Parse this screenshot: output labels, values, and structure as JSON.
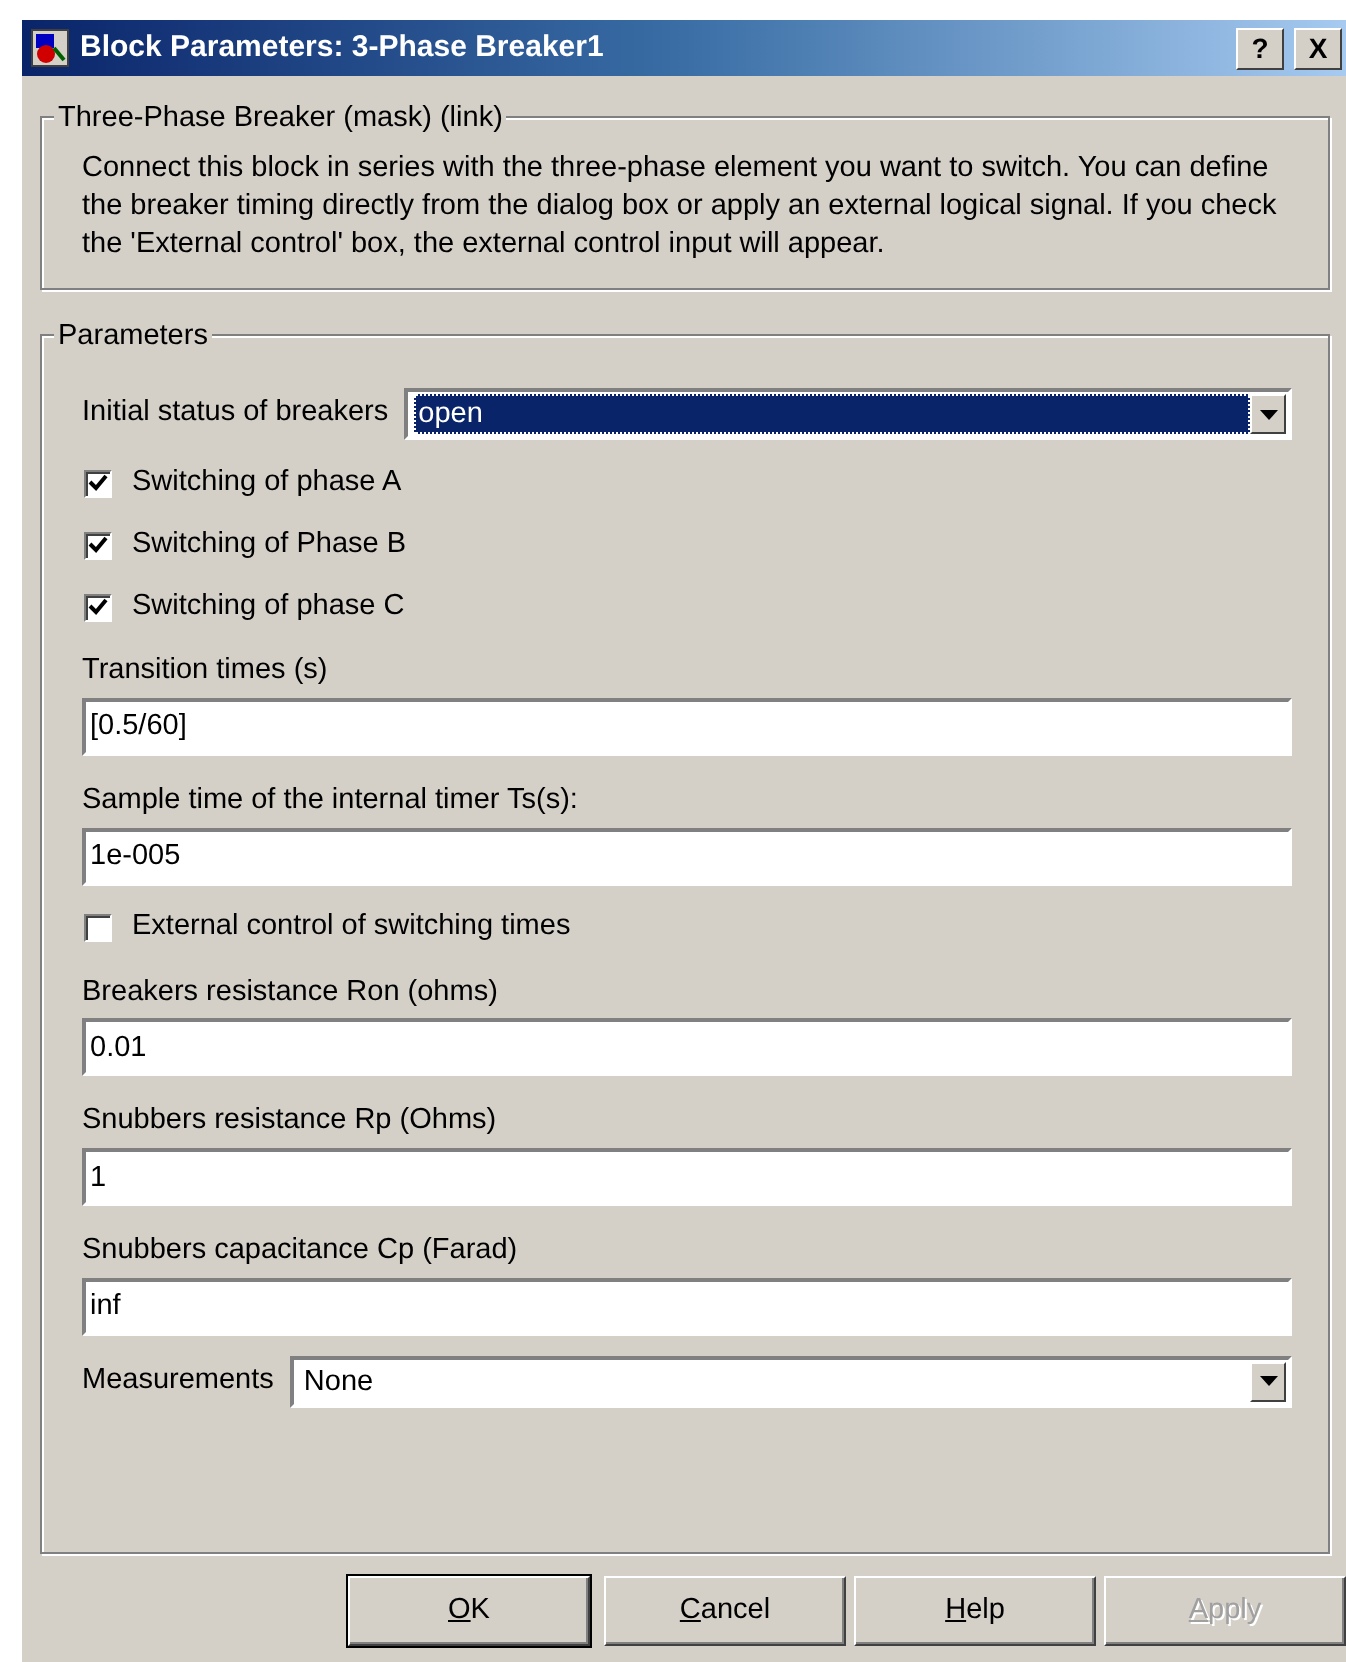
{
  "window": {
    "title": "Block Parameters: 3-Phase Breaker1",
    "help_glyph": "?",
    "close_glyph": "X"
  },
  "description": {
    "legend": "Three-Phase Breaker (mask) (link)",
    "text": "Connect this block in series with the three-phase element you want to switch. You can define the breaker timing directly from the dialog box or apply an external logical signal. If you check  the 'External control' box, the external control input will appear."
  },
  "parameters": {
    "legend": "Parameters",
    "items": [
      {
        "kind": "dropdown",
        "label": "Initial status of breakers",
        "value": "open",
        "focused": true
      },
      {
        "kind": "checkbox",
        "label": "Switching of phase A",
        "checked": true
      },
      {
        "kind": "checkbox",
        "label": "Switching of Phase B",
        "checked": true
      },
      {
        "kind": "checkbox",
        "label": "Switching of phase C",
        "checked": true
      },
      {
        "kind": "text",
        "label": "Transition times (s)",
        "value": "[0.5/60]"
      },
      {
        "kind": "text",
        "label": "Sample time of the internal timer Ts(s):",
        "value": "1e-005"
      },
      {
        "kind": "checkbox",
        "label": "External control of switching times",
        "checked": false
      },
      {
        "kind": "text",
        "label": "Breakers resistance Ron (ohms)",
        "value": "0.01"
      },
      {
        "kind": "text",
        "label": "Snubbers resistance Rp (Ohms)",
        "value": "1"
      },
      {
        "kind": "text",
        "label": "Snubbers capacitance Cp (Farad)",
        "value": "inf"
      },
      {
        "kind": "dropdown",
        "label": "Measurements",
        "value": "None",
        "focused": false
      }
    ]
  },
  "buttons": [
    {
      "label": "OK",
      "default": true,
      "disabled": false
    },
    {
      "label": "Cancel",
      "default": false,
      "disabled": false
    },
    {
      "label": "Help",
      "default": false,
      "disabled": false
    },
    {
      "label": "Apply",
      "default": false,
      "disabled": true
    }
  ]
}
